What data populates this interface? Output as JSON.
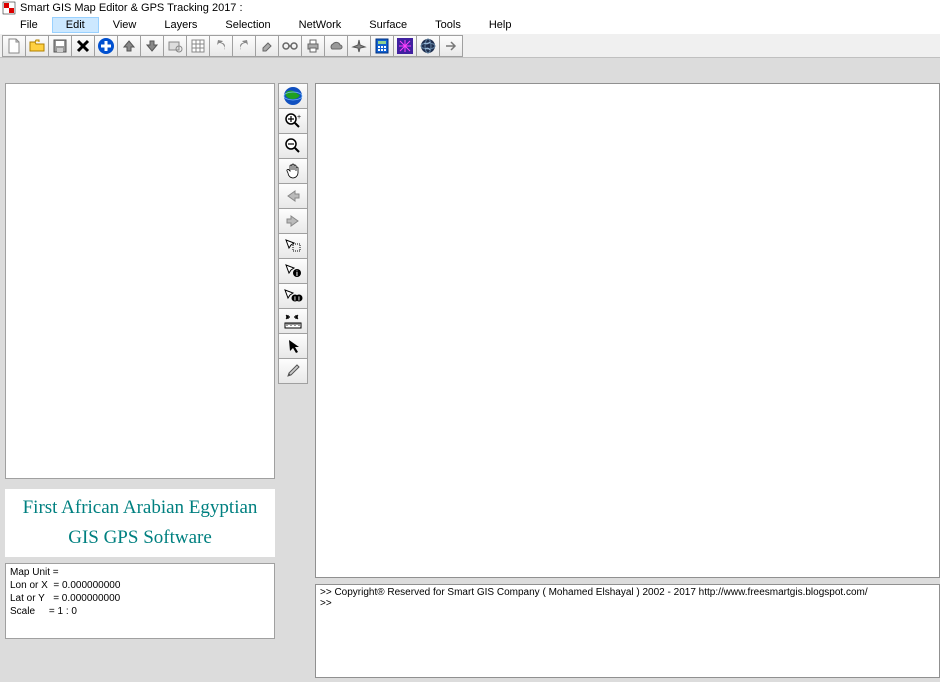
{
  "title": "Smart GIS Map Editor & GPS Tracking 2017 :",
  "menu": [
    "File",
    "Edit",
    "View",
    "Layers",
    "Selection",
    "NetWork",
    "Surface",
    "Tools",
    "Help"
  ],
  "menu_highlighted_index": 1,
  "top_toolbar_icons": [
    "new-document-icon",
    "open-folder-icon",
    "save-icon",
    "delete-icon",
    "add-plus-icon",
    "arrow-up-icon",
    "arrow-down-icon",
    "layer-props-icon",
    "table-icon",
    "undo-icon",
    "redo-icon",
    "eraser-icon",
    "binoculars-icon",
    "print-icon",
    "cloud-icon",
    "airplane-icon",
    "calculator-icon",
    "burst-icon",
    "globe-black-icon",
    "nav-icon"
  ],
  "vertical_toolbar_icons": [
    "full-extent-globe-icon",
    "zoom-in-icon",
    "zoom-out-icon",
    "pan-hand-icon",
    "back-arrow-icon",
    "forward-arrow-icon",
    "select-rect-icon",
    "identify-icon",
    "identify-many-icon",
    "measure-icon",
    "pointer-icon",
    "edit-pen-icon"
  ],
  "banner": {
    "line1": "First African Arabian Egyptian",
    "line2": "GIS GPS Software"
  },
  "status": {
    "map_unit_label": "Map Unit =",
    "map_unit_value": "",
    "lon_label": "Lon or X",
    "lon_value": "= 0.000000000",
    "lat_label": "Lat or Y",
    "lat_value": "= 0.000000000",
    "scale_label": "Scale",
    "scale_value": "= 1 : 0"
  },
  "log": {
    "line1": ">>   Copyright® Reserved for Smart GIS Company ( Mohamed Elshayal ) 2002 - 2017  http://www.freesmartgis.blogspot.com/",
    "line2": ">>"
  }
}
